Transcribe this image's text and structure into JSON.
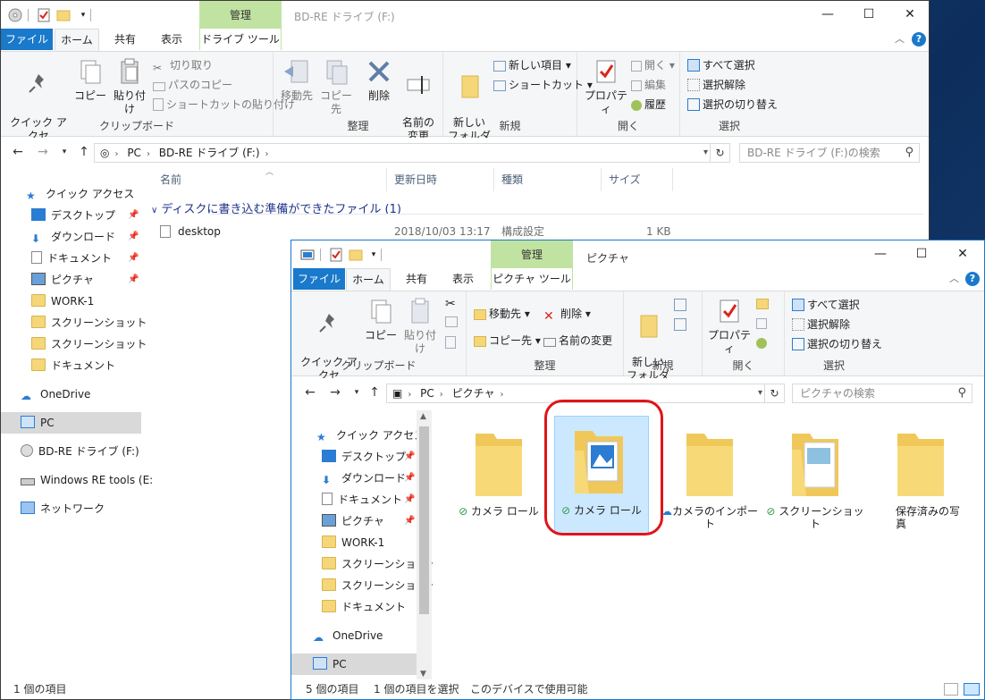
{
  "back_window": {
    "title": "BD-RE ドライブ (F:)",
    "context_tab_header": "管理",
    "tabs": [
      "ファイル",
      "ホーム",
      "共有",
      "表示",
      "ドライブ ツール"
    ],
    "ribbon": {
      "clipboard": {
        "label": "クリップボード",
        "pin": "クイック アクセ\nスにピン留め",
        "copy": "コピー",
        "paste": "貼り付け",
        "cut": "切り取り",
        "copy_path": "パスのコピー",
        "paste_shortcut": "ショートカットの貼り付け"
      },
      "organize": {
        "label": "整理",
        "move": "移動先",
        "copyto": "コピー先",
        "delete": "削除",
        "rename": "名前の\n変更"
      },
      "new": {
        "label": "新規",
        "new_folder": "新しい\nフォルダー",
        "new_item": "新しい項目",
        "shortcut": "ショートカット"
      },
      "open": {
        "label": "開く",
        "properties": "プロパティ",
        "open": "開く",
        "edit": "編集",
        "history": "履歴"
      },
      "select": {
        "label": "選択",
        "select_all": "すべて選択",
        "select_none": "選択解除",
        "invert": "選択の切り替え"
      }
    },
    "address": [
      "PC",
      "BD-RE ドライブ (F:)"
    ],
    "search_placeholder": "BD-RE ドライブ (F:)の検索",
    "columns": [
      "名前",
      "更新日時",
      "種類",
      "サイズ"
    ],
    "group_header": "ディスクに書き込む準備ができたファイル (1)",
    "files": [
      {
        "name": "desktop",
        "date": "2018/10/03 13:17",
        "type": "構成設定",
        "size": "1 KB"
      }
    ],
    "nav": {
      "quick_access": "クイック アクセス",
      "items": [
        "デスクトップ",
        "ダウンロード",
        "ドキュメント",
        "ピクチャ",
        "WORK-1",
        "スクリーンショット",
        "スクリーンショット",
        "ドキュメント"
      ],
      "onedrive": "OneDrive",
      "pc": "PC",
      "bdre": "BD-RE ドライブ (F:)",
      "winre": "Windows RE tools (E:",
      "network": "ネットワーク"
    },
    "status": "1 個の項目"
  },
  "front_window": {
    "title": "ピクチャ",
    "context_tab_header": "管理",
    "tabs": [
      "ファイル",
      "ホーム",
      "共有",
      "表示",
      "ピクチャ ツール"
    ],
    "ribbon": {
      "clipboard": {
        "label": "クリップボード",
        "pin": "クイック アクセ\nスにピン留め",
        "copy": "コピー",
        "paste": "貼り付け"
      },
      "organize": {
        "label": "整理",
        "move": "移動先",
        "copyto": "コピー先",
        "delete": "削除",
        "rename": "名前の変更"
      },
      "new": {
        "label": "新規",
        "new_folder": "新しい\nフォルダー"
      },
      "open": {
        "label": "開く",
        "properties": "プロパティ"
      },
      "select": {
        "label": "選択",
        "select_all": "すべて選択",
        "select_none": "選択解除",
        "invert": "選択の切り替え"
      }
    },
    "address": [
      "PC",
      "ピクチャ"
    ],
    "search_placeholder": "ピクチャの検索",
    "nav": {
      "quick_access": "クイック アクセス",
      "items": [
        "デスクトップ",
        "ダウンロード",
        "ドキュメント",
        "ピクチャ",
        "WORK-1",
        "スクリーンショット",
        "スクリーンショット",
        "ドキュメント"
      ],
      "onedrive": "OneDrive",
      "pc": "PC"
    },
    "folders": [
      {
        "name": "カメラ ロール",
        "sync": "ok",
        "selected": false
      },
      {
        "name": "カメラ ロール",
        "sync": "ok",
        "selected": true
      },
      {
        "name": "カメラのインポート",
        "sync": "cloud",
        "selected": false
      },
      {
        "name": "スクリーンショット",
        "sync": "ok",
        "selected": false
      },
      {
        "name": "保存済みの写\n真",
        "sync": "",
        "selected": false
      }
    ],
    "status": {
      "count": "5 個の項目",
      "selected": "1 個の項目を選択",
      "avail": "このデバイスで使用可能"
    }
  }
}
